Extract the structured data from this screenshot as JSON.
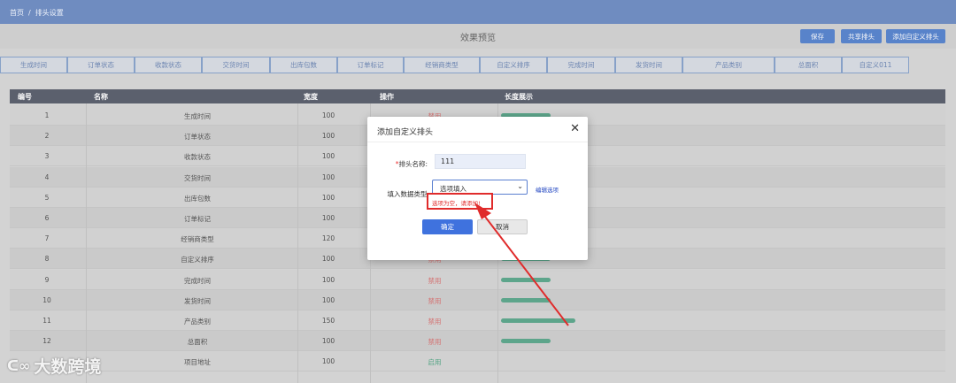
{
  "breadcrumb": {
    "home": "首页",
    "sep": "/",
    "current": "排头设置"
  },
  "preview": {
    "title": "效果预览"
  },
  "toolbar": {
    "save": "保存",
    "share": "共享排头",
    "add_custom": "添加自定义排头"
  },
  "columns": [
    "生成时间",
    "订单状态",
    "收款状态",
    "交货时间",
    "出库包数",
    "订单标记",
    "经销商类型",
    "自定义排序",
    "完成时间",
    "发货时间",
    "产品类别",
    "总面积",
    "自定义011"
  ],
  "table": {
    "headers": {
      "no": "编号",
      "name": "名称",
      "width": "宽度",
      "op": "操作",
      "len": "长度展示"
    },
    "rows": [
      {
        "no": "1",
        "name": "生成时间",
        "width": "100",
        "op": "禁用",
        "op_state": "disabled",
        "len_ratio": 0.5
      },
      {
        "no": "2",
        "name": "订单状态",
        "width": "100",
        "op": "",
        "op_state": "",
        "len_ratio": 0
      },
      {
        "no": "3",
        "name": "收款状态",
        "width": "100",
        "op": "",
        "op_state": "",
        "len_ratio": 0
      },
      {
        "no": "4",
        "name": "交货时间",
        "width": "100",
        "op": "",
        "op_state": "",
        "len_ratio": 0
      },
      {
        "no": "5",
        "name": "出库包数",
        "width": "100",
        "op": "",
        "op_state": "",
        "len_ratio": 0
      },
      {
        "no": "6",
        "name": "订单标记",
        "width": "100",
        "op": "",
        "op_state": "",
        "len_ratio": 0
      },
      {
        "no": "7",
        "name": "经销商类型",
        "width": "120",
        "op": "",
        "op_state": "",
        "len_ratio": 0
      },
      {
        "no": "8",
        "name": "自定义排序",
        "width": "100",
        "op": "禁用",
        "op_state": "disabled",
        "len_ratio": 0.5
      },
      {
        "no": "9",
        "name": "完成时间",
        "width": "100",
        "op": "禁用",
        "op_state": "disabled",
        "len_ratio": 0.5
      },
      {
        "no": "10",
        "name": "发货时间",
        "width": "100",
        "op": "禁用",
        "op_state": "disabled",
        "len_ratio": 0.5
      },
      {
        "no": "11",
        "name": "产品类别",
        "width": "150",
        "op": "禁用",
        "op_state": "disabled",
        "len_ratio": 0.75
      },
      {
        "no": "12",
        "name": "总面积",
        "width": "100",
        "op": "禁用",
        "op_state": "disabled",
        "len_ratio": 0.5
      },
      {
        "no": "",
        "name": "项目地址",
        "width": "100",
        "op": "启用",
        "op_state": "enabled",
        "len_ratio": 0
      }
    ]
  },
  "modal": {
    "title": "添加自定义排头",
    "close_icon": "close-icon",
    "name_label": "排头名称:",
    "name_required": "*",
    "name_value": "111",
    "type_label": "填入数据类型:",
    "type_value": "选项填入",
    "edit_link": "编辑选项",
    "error": "选项为空，请添加!",
    "ok": "确定",
    "cancel": "取消"
  },
  "watermark": {
    "text": "大数跨境"
  },
  "colors": {
    "topbar": "#6f8cc0",
    "accent": "#3f72de",
    "error": "#e02b2b",
    "bar": "#5fa98e"
  }
}
